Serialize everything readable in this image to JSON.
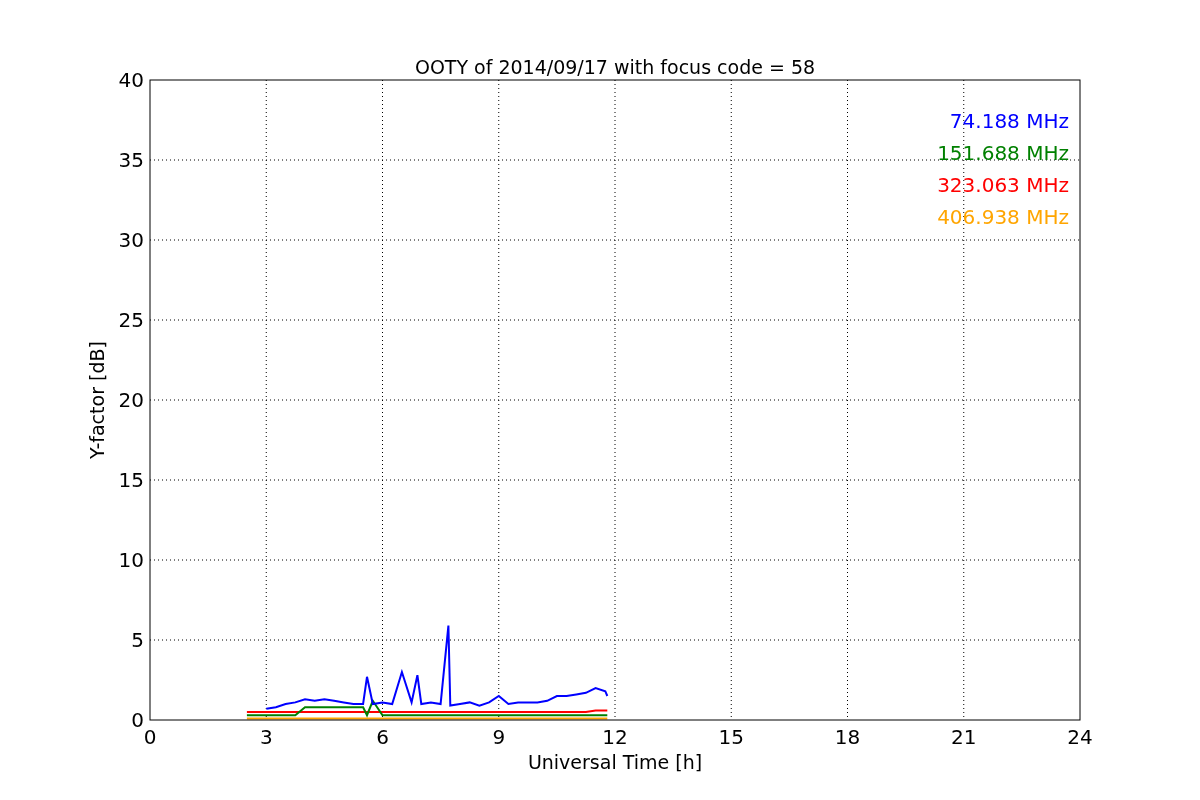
{
  "chart_data": {
    "type": "line",
    "grid": true,
    "title": "OOTY of 2014/09/17 with focus code = 58",
    "xlabel": "Universal Time [h]",
    "ylabel": "Y-factor [dB]",
    "xlim": [
      0,
      24
    ],
    "ylim": [
      0,
      40
    ],
    "xticks": [
      0,
      3,
      6,
      9,
      12,
      15,
      18,
      21,
      24
    ],
    "yticks": [
      0,
      5,
      10,
      15,
      20,
      25,
      30,
      35,
      40
    ],
    "x": [
      2.5,
      2.75,
      3,
      3.25,
      3.5,
      3.75,
      4,
      4.25,
      4.5,
      4.75,
      5,
      5.25,
      5.5,
      5.6,
      5.75,
      6,
      6.25,
      6.5,
      6.75,
      6.9,
      7,
      7.25,
      7.5,
      7.7,
      7.75,
      8,
      8.25,
      8.5,
      8.75,
      9,
      9.25,
      9.5,
      9.75,
      10,
      10.25,
      10.5,
      10.75,
      11,
      11.25,
      11.5,
      11.75,
      11.8
    ],
    "series": [
      {
        "name": "74.188 MHz",
        "color": "#0000ff",
        "values": [
          null,
          null,
          0.7,
          0.8,
          1.0,
          1.1,
          1.3,
          1.2,
          1.3,
          1.2,
          1.1,
          1.0,
          1.0,
          2.7,
          1.0,
          1.1,
          1.0,
          3.0,
          1.1,
          2.8,
          1.0,
          1.1,
          1.0,
          5.9,
          0.9,
          1.0,
          1.1,
          0.9,
          1.1,
          1.5,
          1.0,
          1.1,
          1.1,
          1.1,
          1.2,
          1.5,
          1.5,
          1.6,
          1.7,
          2.0,
          1.8,
          1.5
        ]
      },
      {
        "name": "151.688 MHz",
        "color": "#008000",
        "values": [
          0.3,
          0.3,
          0.3,
          0.3,
          0.3,
          0.3,
          0.8,
          0.8,
          0.8,
          0.8,
          0.8,
          0.8,
          0.8,
          0.3,
          1.2,
          0.3,
          0.3,
          0.3,
          0.3,
          0.3,
          0.3,
          0.3,
          0.3,
          0.3,
          0.3,
          0.3,
          0.3,
          0.3,
          0.3,
          0.3,
          0.3,
          0.3,
          0.3,
          0.3,
          0.3,
          0.3,
          0.3,
          0.3,
          0.3,
          0.3,
          0.3,
          0.3
        ]
      },
      {
        "name": "323.063 MHz",
        "color": "#ff0000",
        "values": [
          0.5,
          0.5,
          0.5,
          0.5,
          0.5,
          0.5,
          0.5,
          0.5,
          0.5,
          0.5,
          0.5,
          0.5,
          0.5,
          0.5,
          0.5,
          0.5,
          0.5,
          0.5,
          0.5,
          0.5,
          0.5,
          0.5,
          0.5,
          0.5,
          0.5,
          0.5,
          0.5,
          0.5,
          0.5,
          0.5,
          0.5,
          0.5,
          0.5,
          0.5,
          0.5,
          0.5,
          0.5,
          0.5,
          0.5,
          0.6,
          0.6,
          0.6
        ]
      },
      {
        "name": "406.938 MHz",
        "color": "#ffa500",
        "values": [
          0.1,
          0.1,
          0.1,
          0.1,
          0.1,
          0.1,
          0.1,
          0.1,
          0.1,
          0.1,
          0.1,
          0.1,
          0.1,
          0.1,
          0.1,
          0.1,
          0.1,
          0.1,
          0.1,
          0.1,
          0.1,
          0.1,
          0.1,
          0.1,
          0.1,
          0.1,
          0.1,
          0.1,
          0.1,
          0.1,
          0.1,
          0.1,
          0.1,
          0.1,
          0.1,
          0.1,
          0.1,
          0.1,
          0.1,
          0.1,
          0.1,
          0.1
        ]
      }
    ]
  }
}
